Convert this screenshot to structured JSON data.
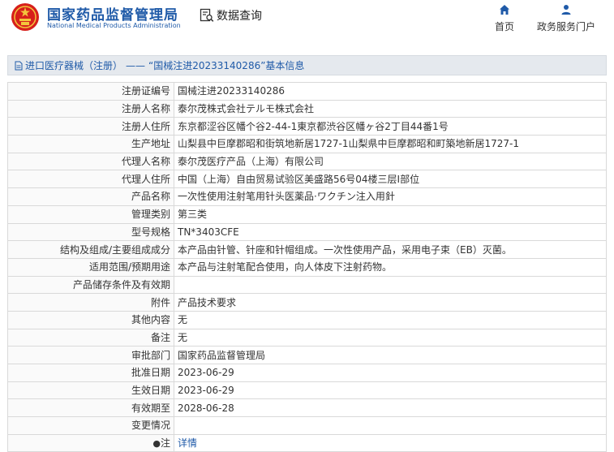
{
  "header": {
    "org_name_cn": "国家药品监督管理局",
    "org_name_en": "National Medical Products Administration",
    "query_label": "数据查询",
    "nav_home": "首页",
    "nav_portal": "政务服务门户",
    "colors": {
      "brand": "#1f5aa8",
      "emblem_red": "#d7201b",
      "emblem_gold": "#f3c53c"
    }
  },
  "breadcrumb": {
    "link": "进口医疗器械（注册）",
    "separator": "——",
    "current": "“国械注进20233140286”基本信息"
  },
  "detail": {
    "rows": [
      {
        "label": "注册证编号",
        "value": "国械注进20233140286"
      },
      {
        "label": "注册人名称",
        "value": "泰尔茂株式会社テルモ株式会社"
      },
      {
        "label": "注册人住所",
        "value": "东京都涩谷区幡个谷2-44-1東京都渋谷区幡ヶ谷2丁目44番1号"
      },
      {
        "label": "生产地址",
        "value": "山梨县中巨摩郡昭和街筑地新居1727-1山梨県中巨摩郡昭和町築地新居1727-1"
      },
      {
        "label": "代理人名称",
        "value": "泰尔茂医疗产品（上海）有限公司"
      },
      {
        "label": "代理人住所",
        "value": "中国（上海）自由贸易试验区美盛路56号04楼三层I部位"
      },
      {
        "label": "产品名称",
        "value": "一次性使用注射笔用针头医薬品·ワクチン注入用針"
      },
      {
        "label": "管理类别",
        "value": "第三类"
      },
      {
        "label": "型号规格",
        "value": "TN*3403CFE"
      },
      {
        "label": "结构及组成/主要组成成分",
        "value": "本产品由针管、针座和针帽组成。一次性使用产品，采用电子束（EB）灭菌。"
      },
      {
        "label": "适用范围/预期用途",
        "value": "本产品与注射笔配合使用，向人体皮下注射药物。"
      },
      {
        "label": "产品储存条件及有效期",
        "value": ""
      },
      {
        "label": "附件",
        "value": "产品技术要求"
      },
      {
        "label": "其他内容",
        "value": "无"
      },
      {
        "label": "备注",
        "value": "无"
      },
      {
        "label": "审批部门",
        "value": "国家药品监督管理局"
      },
      {
        "label": "批准日期",
        "value": "2023-06-29"
      },
      {
        "label": "生效日期",
        "value": "2023-06-29"
      },
      {
        "label": "有效期至",
        "value": "2028-06-28"
      },
      {
        "label": "变更情况",
        "value": ""
      }
    ],
    "note": {
      "icon": "pin-icon",
      "label": "注",
      "link": "详情"
    }
  }
}
